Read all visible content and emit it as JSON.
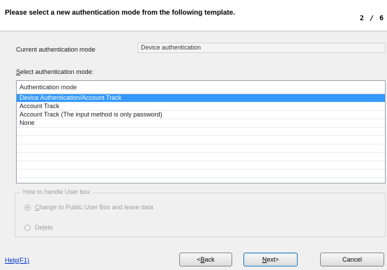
{
  "header": {
    "title": "Please select a new authentication mode from the following template.",
    "step": "2 / 6"
  },
  "current_mode": {
    "label": "Current authentication mode",
    "value": "Device authentication"
  },
  "select_mode": {
    "label_accel": "S",
    "label_rest": "elect authentication mode:",
    "column_header": "Authentication mode",
    "items": [
      "Device Authentication/Account Track",
      "Account Track",
      "Account Track (The input method is only password)",
      "None"
    ],
    "selected_index": 0
  },
  "user_box": {
    "legend": "How to handle User box",
    "option1": {
      "accel": "C",
      "rest": "hange to Public User Box and leave data",
      "selected": true
    },
    "option2": {
      "pre": "De",
      "accel": "l",
      "post": "ete",
      "selected": false
    }
  },
  "footer": {
    "help": "Help(F1)",
    "back": {
      "pre": "<",
      "accel": "B",
      "post": "ack"
    },
    "next": {
      "accel": "N",
      "post": "ext>"
    },
    "cancel": "Cancel"
  }
}
